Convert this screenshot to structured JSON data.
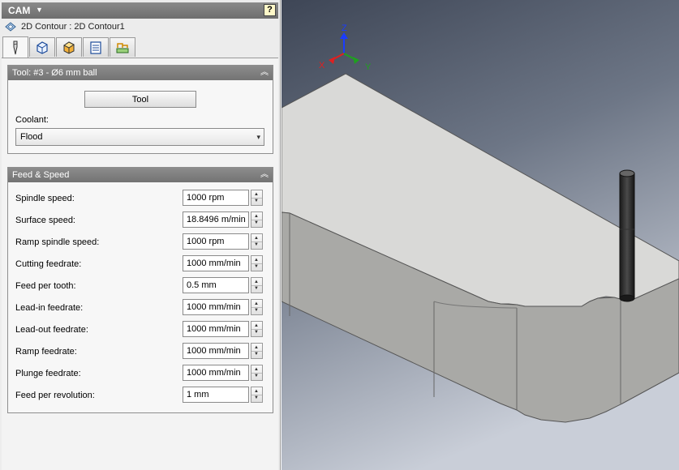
{
  "header": {
    "title": "CAM",
    "help_label": "?"
  },
  "breadcrumb": {
    "text": "2D Contour : 2D Contour1"
  },
  "tabs": [
    {
      "icon": "tool-icon",
      "active": true
    },
    {
      "icon": "geometry-icon"
    },
    {
      "icon": "heights-icon"
    },
    {
      "icon": "passes-icon"
    },
    {
      "icon": "linking-icon"
    }
  ],
  "tool_group": {
    "header": "Tool: #3 - Ø6 mm ball",
    "tool_button": "Tool",
    "coolant_label": "Coolant:",
    "coolant_value": "Flood"
  },
  "feed_group": {
    "header": "Feed & Speed",
    "rows": [
      {
        "label": "Spindle speed:",
        "value": "1000 rpm"
      },
      {
        "label": "Surface speed:",
        "value": "18.8496 m/min"
      },
      {
        "label": "Ramp spindle speed:",
        "value": "1000 rpm"
      },
      {
        "label": "Cutting feedrate:",
        "value": "1000 mm/min"
      },
      {
        "label": "Feed per tooth:",
        "value": "0.5 mm"
      },
      {
        "label": "Lead-in feedrate:",
        "value": "1000 mm/min"
      },
      {
        "label": "Lead-out feedrate:",
        "value": "1000 mm/min"
      },
      {
        "label": "Ramp feedrate:",
        "value": "1000 mm/min"
      },
      {
        "label": "Plunge feedrate:",
        "value": "1000 mm/min"
      },
      {
        "label": "Feed per revolution:",
        "value": "1 mm"
      }
    ]
  },
  "viewport": {
    "axis_labels": {
      "z": "Z",
      "x": "X",
      "y": "Y"
    },
    "axis_colors": {
      "z": "#1a3cff",
      "x": "#e02020",
      "y": "#1fa01f"
    }
  }
}
